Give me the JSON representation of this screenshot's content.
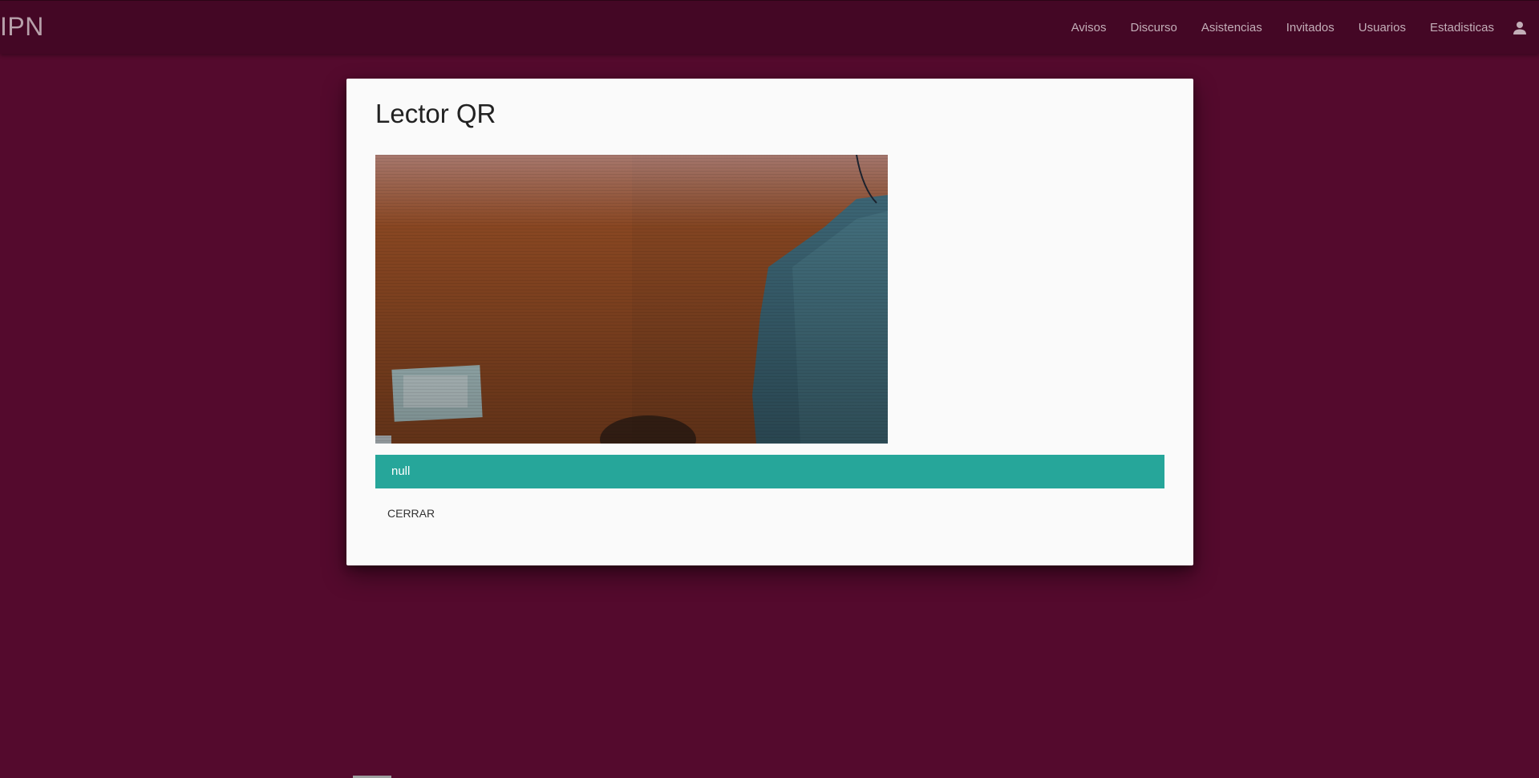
{
  "navbar": {
    "brand": "IPN",
    "links": [
      {
        "label": "Avisos"
      },
      {
        "label": "Discurso"
      },
      {
        "label": "Asistencias"
      },
      {
        "label": "Invitados"
      },
      {
        "label": "Usuarios"
      },
      {
        "label": "Estadisticas"
      }
    ],
    "user_icon": "person-icon"
  },
  "modal": {
    "title": "Lector QR",
    "camera_feed": "camera-preview",
    "result_text": "null",
    "close_label": "CERRAR"
  },
  "colors": {
    "page_background": "#540a2d",
    "navbar_background": "#440725",
    "modal_background": "#fafafa",
    "result_bar": "#26a69a"
  }
}
